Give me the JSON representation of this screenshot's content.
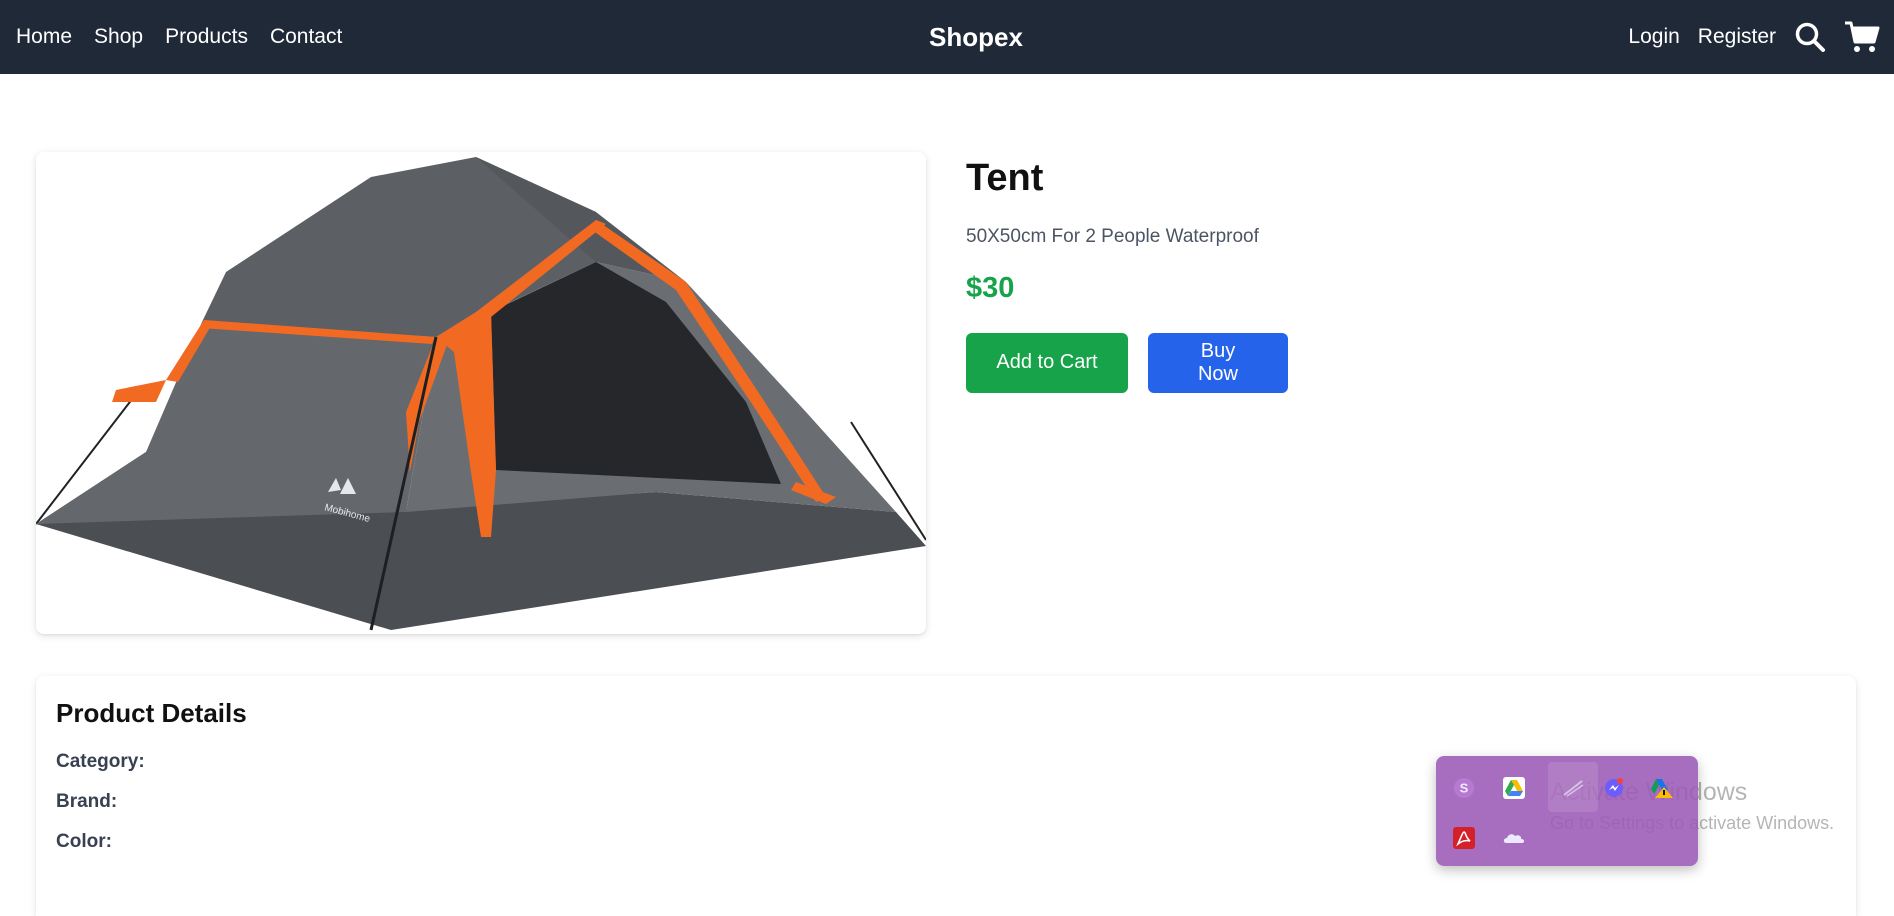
{
  "navbar": {
    "links": [
      "Home",
      "Shop",
      "Products",
      "Contact"
    ],
    "brand": "Shopex",
    "login": "Login",
    "register": "Register",
    "search_icon": "search-icon",
    "cart_icon": "cart-icon"
  },
  "product": {
    "title": "Tent",
    "description": "50X50cm For 2 People Waterproof",
    "price": "$30",
    "add_to_cart_label": "Add to Cart",
    "buy_now_label": "Buy Now",
    "image_logo_text": "Mobihome"
  },
  "details": {
    "title": "Product Details",
    "category_label": "Category:",
    "brand_label": "Brand:",
    "color_label": "Color:"
  },
  "watermark": {
    "title": "Activate Windows",
    "subtitle": "Go to Settings to activate Windows."
  },
  "tray": {
    "icons": [
      "skype-icon",
      "google-drive-icon",
      "pen-icon",
      "messenger-icon",
      "drive-warning-icon",
      "acrobat-icon",
      "onedrive-icon"
    ]
  },
  "colors": {
    "navbar_bg": "#1f2937",
    "price": "#16a34a",
    "add_to_cart": "#16a34a",
    "buy_now": "#2563eb",
    "tray_bg": "#9b59b6"
  }
}
